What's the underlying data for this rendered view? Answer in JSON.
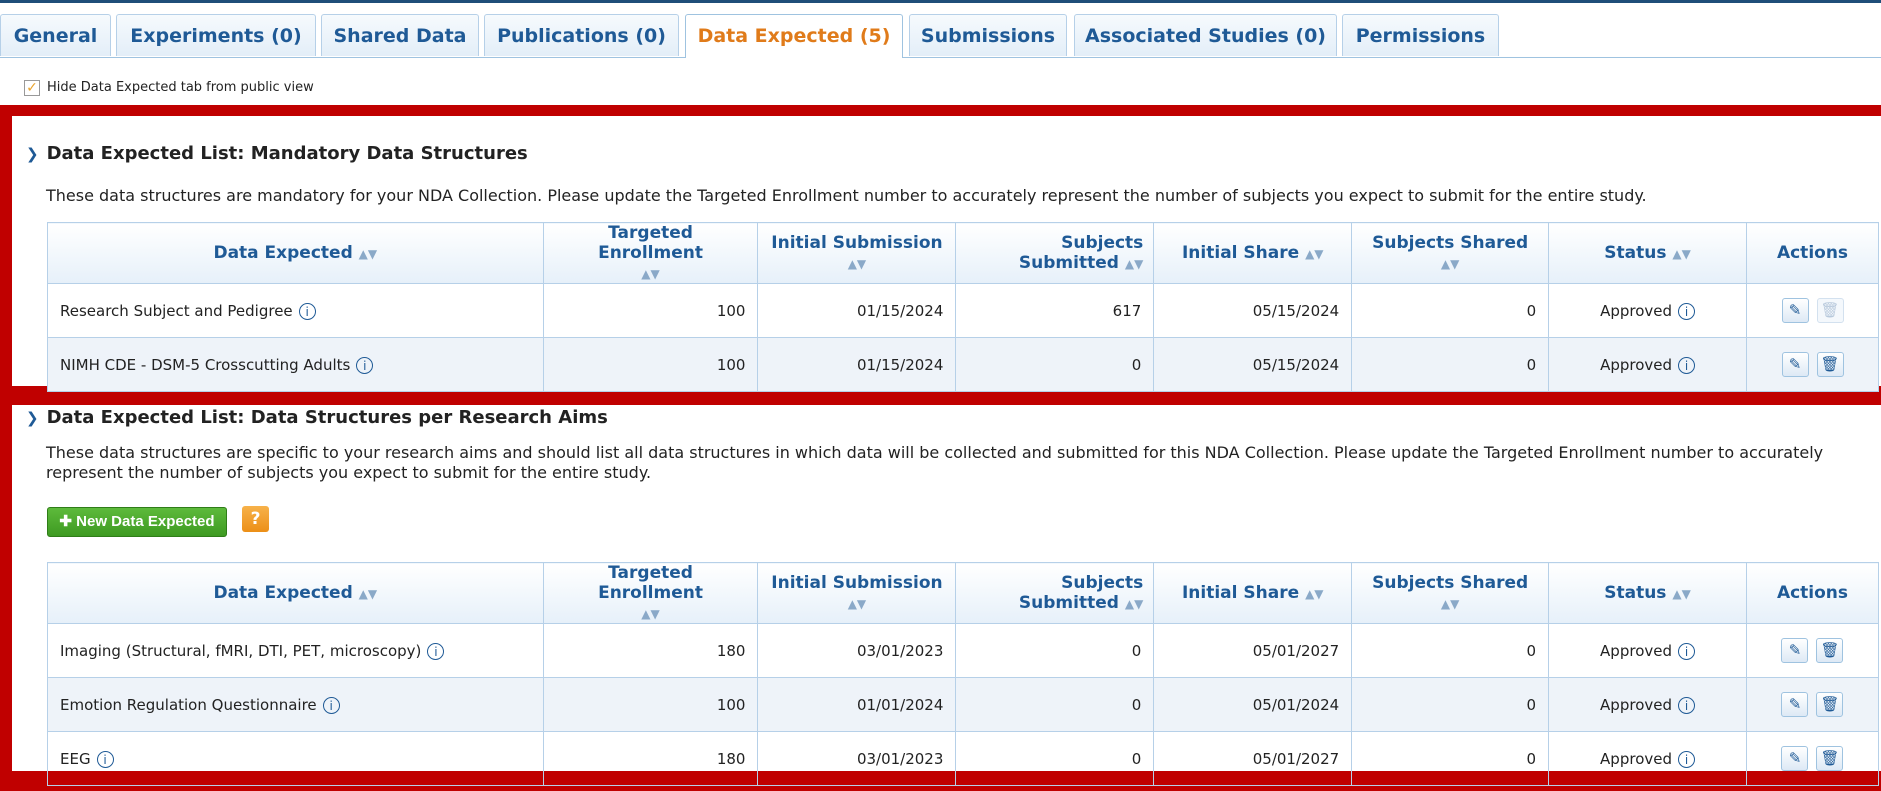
{
  "tabs": [
    {
      "label": "General"
    },
    {
      "label": "Experiments (0)"
    },
    {
      "label": "Shared Data"
    },
    {
      "label": "Publications (0)"
    },
    {
      "label": "Data Expected (5)"
    },
    {
      "label": "Submissions"
    },
    {
      "label": "Associated Studies (0)"
    },
    {
      "label": "Permissions"
    }
  ],
  "active_tab": "Data Expected (5)",
  "hide_option": {
    "label": "Hide Data Expected tab from public view",
    "checked": true
  },
  "columns": [
    "Data Expected",
    "Targeted Enrollment",
    "Initial Submission",
    "Subjects Submitted",
    "Initial Share",
    "Subjects Shared",
    "Status",
    "Actions"
  ],
  "mandatory": {
    "title": "Data Expected List: Mandatory Data Structures",
    "description": "These data structures are mandatory for your NDA Collection. Please update the Targeted Enrollment number to accurately represent the number of subjects you expect to submit for the entire study.",
    "rows": [
      {
        "name": "Research Subject and Pedigree",
        "enrollment": "100",
        "initial_submission": "01/15/2024",
        "subjects_submitted": "617",
        "initial_share": "05/15/2024",
        "subjects_shared": "0",
        "status": "Approved",
        "delete_enabled": false
      },
      {
        "name": "NIMH CDE - DSM-5 Crosscutting Adults",
        "enrollment": "100",
        "initial_submission": "01/15/2024",
        "subjects_submitted": "0",
        "initial_share": "05/15/2024",
        "subjects_shared": "0",
        "status": "Approved",
        "delete_enabled": true
      }
    ]
  },
  "research_aims": {
    "title": "Data Expected List: Data Structures per Research Aims",
    "description_line1": "These data structures are specific to your research aims and should list all data structures in which data will be collected and submitted for this NDA Collection. Please update the Targeted Enrollment number to accurately",
    "description_line2": "represent the number of subjects you expect to submit for the entire study.",
    "new_button": "New Data Expected",
    "help_button": "?",
    "rows": [
      {
        "name": "Imaging (Structural, fMRI, DTI, PET, microscopy)",
        "enrollment": "180",
        "initial_submission": "03/01/2023",
        "subjects_submitted": "0",
        "initial_share": "05/01/2027",
        "subjects_shared": "0",
        "status": "Approved",
        "delete_enabled": true
      },
      {
        "name": "Emotion Regulation Questionnaire",
        "enrollment": "100",
        "initial_submission": "01/01/2024",
        "subjects_submitted": "0",
        "initial_share": "05/01/2024",
        "subjects_shared": "0",
        "status": "Approved",
        "delete_enabled": true
      },
      {
        "name": "EEG",
        "enrollment": "180",
        "initial_submission": "03/01/2023",
        "subjects_submitted": "0",
        "initial_share": "05/01/2027",
        "subjects_shared": "0",
        "status": "Approved",
        "delete_enabled": true
      }
    ]
  },
  "colors": {
    "frame": "#c00000",
    "tab_text": "#1f5a96",
    "active_tab_text": "#e07b1a",
    "new_button": "#4aa82c",
    "help_button": "#f0a030"
  }
}
